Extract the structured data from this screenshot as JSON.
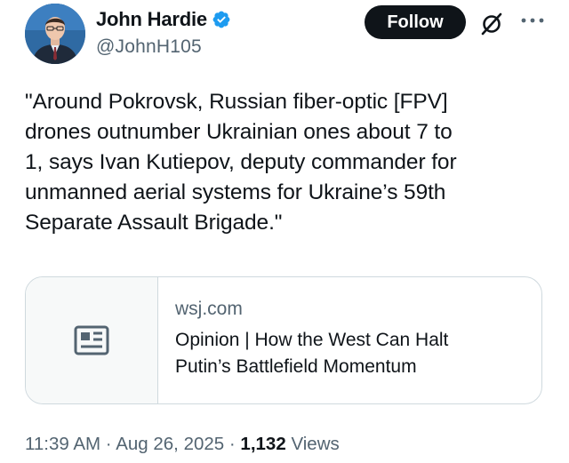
{
  "author": {
    "display_name": "John Hardie",
    "handle": "@JohnH105",
    "verified_icon": "verified-badge-icon",
    "verified_color": "#1d9bf0"
  },
  "actions": {
    "follow_label": "Follow",
    "grok_icon": "grok-icon",
    "more_icon": "more-icon"
  },
  "tweet": {
    "text": "\"Around Pokrovsk, Russian fiber-optic [FPV]\ndrones outnumber Ukrainian ones about 7 to\n1, says Ivan Kutiepov, deputy commander for\nunmanned aerial systems for Ukraine’s 59th\nSeparate Assault Brigade.\""
  },
  "link_card": {
    "icon": "article-icon",
    "domain": "wsj.com",
    "title": "Opinion | How the West Can Halt\nPutin’s Battlefield Momentum"
  },
  "meta": {
    "time": "11:39 AM",
    "separator": "·",
    "date": "Aug 26, 2025",
    "views_count": "1,132",
    "views_label": "Views"
  },
  "colors": {
    "text_primary": "#0f1419",
    "text_secondary": "#536471",
    "border": "#cfd9de",
    "follow_bg": "#0f1419"
  }
}
